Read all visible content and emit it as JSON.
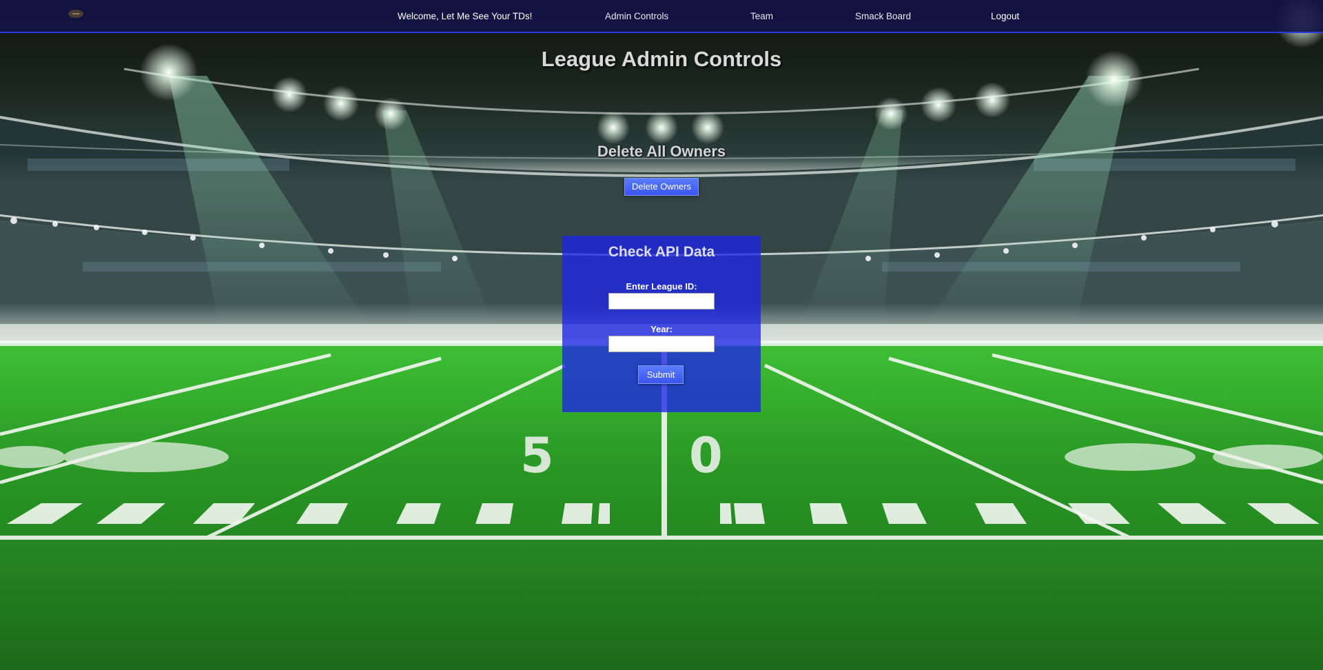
{
  "nav": {
    "logo_icon": "football-logo-icon",
    "items": [
      {
        "label": "Welcome, Let Me See Your TDs!"
      },
      {
        "label": "Admin Controls"
      },
      {
        "label": "Team"
      },
      {
        "label": "Smack Board"
      },
      {
        "label": "Logout"
      }
    ]
  },
  "page": {
    "title": "League Admin Controls"
  },
  "delete_section": {
    "title": "Delete All Owners",
    "button_label": "Delete Owners"
  },
  "api_section": {
    "title": "Check API Data",
    "league_id_label": "Enter League ID:",
    "league_id_value": "",
    "year_label": "Year:",
    "year_value": "",
    "submit_label": "Submit"
  },
  "colors": {
    "nav_bg": "#141446",
    "nav_border": "#2a3be0",
    "button": "#4a68f8",
    "panel": "#1c24e6",
    "field_green": "#2f9a2a"
  }
}
